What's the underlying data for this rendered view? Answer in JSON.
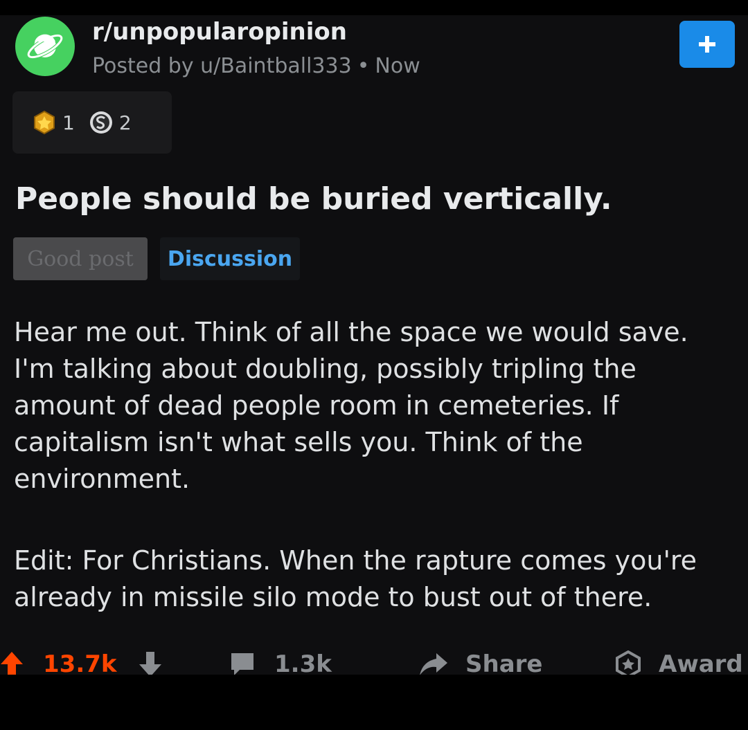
{
  "header": {
    "subreddit": "r/unpopularopinion",
    "posted_by": "Posted by u/Baintball333",
    "separator": "•",
    "time": "Now",
    "join_icon": "plus-icon"
  },
  "awards": [
    {
      "icon": "gold-award-icon",
      "count": "1"
    },
    {
      "icon": "silver-coin-icon",
      "count": "2"
    }
  ],
  "post": {
    "title": "People should be buried vertically.",
    "flairs": [
      "Good post",
      "Discussion"
    ],
    "body": [
      "Hear me out. Think of all the space we would save. I'm talking about doubling, possibly tripling the amount of dead people room in cemeteries. If capitalism isn't what sells you. Think of the environment.",
      "Edit: For Christians. When the rapture comes you're already in missile silo mode to bust out of there."
    ]
  },
  "actions": {
    "upvotes": "13.7k",
    "comments": "1.3k",
    "share": "Share",
    "award": "Award"
  },
  "colors": {
    "background": "#0e0e10",
    "upvote": "#ff4500",
    "join_button": "#1a8be8",
    "flair_link": "#4aa6f0",
    "subreddit_icon": "#46d160"
  }
}
